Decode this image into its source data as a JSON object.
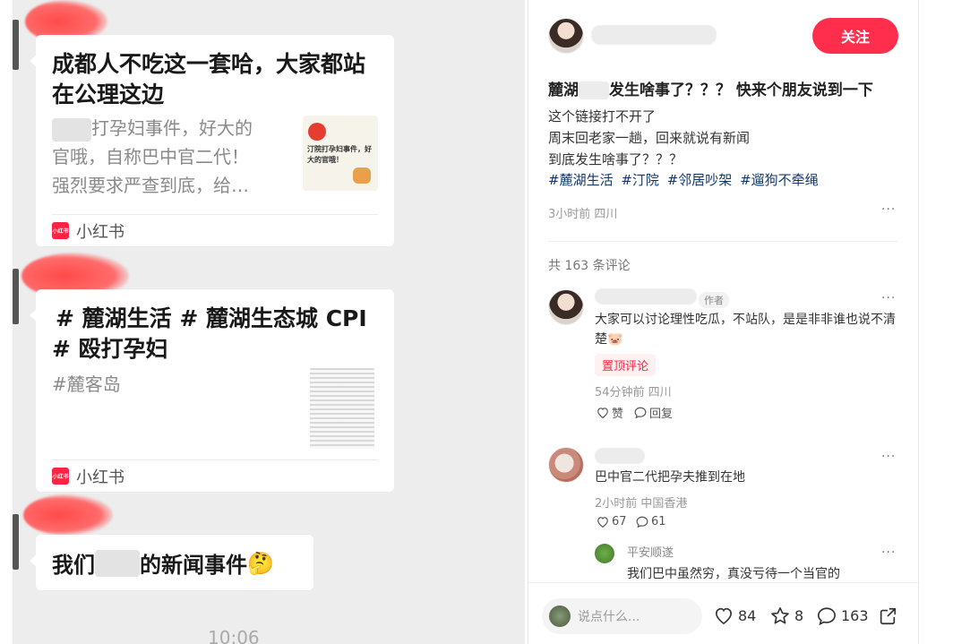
{
  "chat": {
    "card1": {
      "title": "成都人不吃这一套哈，大家都站在公理这边",
      "desc_line1": "打孕妇事件，好大的",
      "desc_line2": "官哦，自称巴中官二代！",
      "desc_line3": "强烈要求严查到底，给…",
      "thumb_text": "汀院打孕妇事件，好大的官哦！",
      "source": "小红书",
      "logo_text": "小红书"
    },
    "card2": {
      "title_line1": "# 麓湖生活 # 麓湖生态城 CPI",
      "title_line2": "# 殴打孕妇",
      "desc": "#麓客岛",
      "source": "小红书",
      "logo_text": "小红书"
    },
    "message3": {
      "text_before": "我们",
      "text_after": "的新闻事件",
      "emoji": "🤔"
    },
    "time": "10:06"
  },
  "post": {
    "follow_label": "关注",
    "title_before": "麓湖",
    "title_after": "发生啥事了？？？ 快来个朋友说到一下",
    "body_lines": [
      "这个链接打不开了",
      "周末回老家一趟，回来就说有新闻",
      "到底发生啥事了？？？"
    ],
    "tags": [
      "#麓湖生活",
      "#汀院",
      "#邻居吵架",
      "#遛狗不牵绳"
    ],
    "meta": "3小时前 四川",
    "more": "···",
    "comment_count": "共 163 条评论",
    "comments": [
      {
        "author_tag": "作者",
        "text_line1": "大家可以讨论理性吃瓜，不站队，是是非非谁也说不清",
        "text_line2": "楚",
        "emoji": "🐷",
        "pin": "置顶评论",
        "meta": "54分钟前 四川",
        "like_label": "赞",
        "reply_label": "回复"
      },
      {
        "text": "巴中官二代把孕夫推到在地",
        "meta": "2小时前 中国香港",
        "likes": "67",
        "replies": "61"
      },
      {
        "name": "平安顺遂",
        "text": "我们巴中虽然穷，真没亏待一个当官的"
      }
    ],
    "input_placeholder": "说点什么...",
    "stats": {
      "likes": "84",
      "stars": "8",
      "comments": "163"
    },
    "accent": "#ff2e4d"
  }
}
